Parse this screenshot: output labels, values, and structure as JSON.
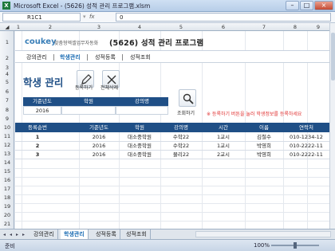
{
  "window": {
    "title": "Microsoft Excel - (5626) 성적 관리 프로그램.xlsm",
    "icon": "excel-icon",
    "buttons": [
      "–",
      "□",
      "×"
    ]
  },
  "formula_bar": {
    "name_box": "R1C1",
    "fx_label": "fx",
    "content": "0"
  },
  "column_headers": [
    "1",
    "2",
    "3",
    "4",
    "5",
    "6",
    "7",
    "8",
    "9",
    "10",
    "11"
  ],
  "row_headers": [
    "1",
    "2",
    "3",
    "4",
    "5",
    "6",
    "7",
    "8",
    "9",
    "10",
    "11",
    "12",
    "13",
    "14",
    "15",
    "16",
    "17",
    "18",
    "19",
    "20",
    "21",
    "22",
    "23",
    "24",
    "25"
  ],
  "header": {
    "logo_main": "coukey",
    "logo_sub": "맞춤형엑셀업무자동화",
    "app_title": "(5626) 성적 관리 프로그램"
  },
  "menu": {
    "items": [
      {
        "label": "강의관리",
        "active": false
      },
      {
        "label": "학생관리",
        "active": true
      },
      {
        "label": "성적등록",
        "active": false
      },
      {
        "label": "성적조회",
        "active": false
      }
    ]
  },
  "page": {
    "heading": "학생 관리",
    "register_label": "등록하기",
    "delete_all_label": "전체삭제",
    "search_label": "조회하기",
    "hint": "※ 등록하기 버튼을 눌러 학생정보를 등록하세요"
  },
  "filters": {
    "headers": [
      "기준년도",
      "학원",
      "강의명"
    ],
    "values": [
      "2016",
      "",
      ""
    ]
  },
  "table": {
    "columns": [
      "등록순번",
      "기준년도",
      "학원",
      "강의명",
      "시간",
      "이름",
      "연락처"
    ],
    "rows": [
      [
        "1",
        "2016",
        "대소중학원",
        "수학22",
        "1교시",
        "김철수",
        "010-1234-12"
      ],
      [
        "2",
        "2016",
        "대소중학원",
        "수학22",
        "1교시",
        "박영희",
        "010-2222-11"
      ],
      [
        "3",
        "2016",
        "대소중학원",
        "물리22",
        "2교시",
        "박영희",
        "010-2222-11"
      ]
    ]
  },
  "sheet_tabs": [
    {
      "label": "강의관리",
      "active": false
    },
    {
      "label": "학생관리",
      "active": true
    },
    {
      "label": "성적등록",
      "active": false
    },
    {
      "label": "성적조회",
      "active": false
    }
  ],
  "status": {
    "ready": "준비",
    "zoom": "100%"
  },
  "colors": {
    "header_blue": "#1f4f86",
    "accent_blue": "#1f6fb5",
    "hint_red": "#e03030",
    "logo_green": "#8cb23f"
  }
}
